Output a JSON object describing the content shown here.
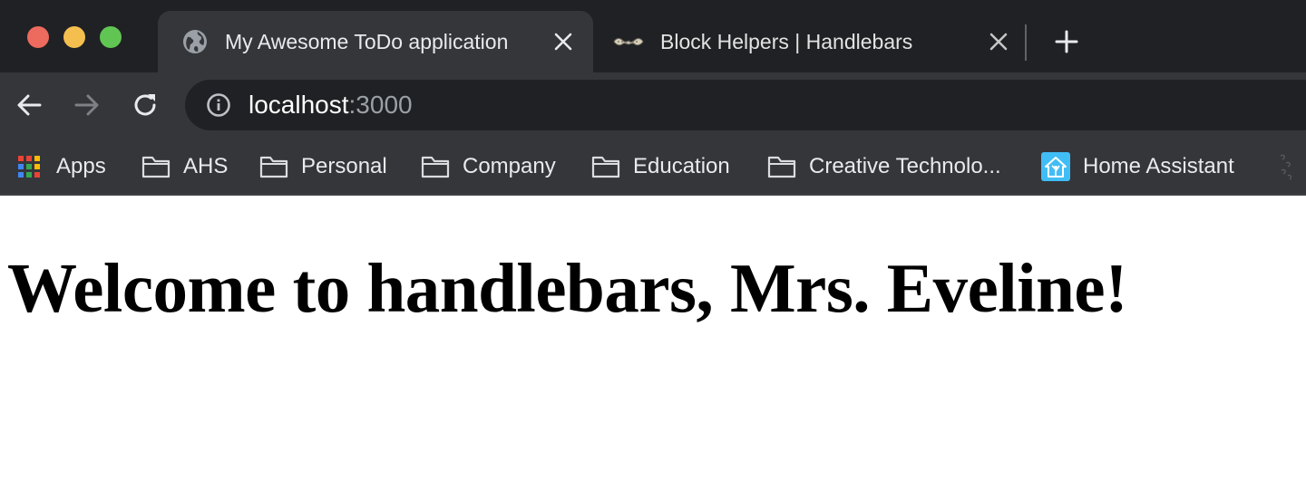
{
  "tabs": [
    {
      "title": "My Awesome ToDo application",
      "icon": "globe-icon",
      "active": true
    },
    {
      "title": "Block Helpers | Handlebars",
      "icon": "handlebars-mustache-icon",
      "active": false
    }
  ],
  "toolbar": {
    "back_icon": "back-arrow-icon",
    "forward_icon": "forward-arrow-icon",
    "reload_icon": "reload-icon",
    "url_host": "localhost",
    "url_port": ":3000"
  },
  "bookmarks": [
    {
      "label": "Apps",
      "icon": "apps-grid-icon"
    },
    {
      "label": "AHS",
      "icon": "folder-icon"
    },
    {
      "label": "Personal",
      "icon": "folder-icon"
    },
    {
      "label": "Company",
      "icon": "folder-icon"
    },
    {
      "label": "Education",
      "icon": "folder-icon"
    },
    {
      "label": "Creative Technolo...",
      "icon": "folder-icon"
    },
    {
      "label": "Home Assistant",
      "icon": "home-assistant-icon"
    }
  ],
  "page": {
    "heading": "Welcome to handlebars, Mrs. Eveline!"
  },
  "colors": {
    "tabstrip_bg": "#202124",
    "toolbar_bg": "#35363a",
    "traffic_red": "#ed6a5e",
    "traffic_yellow": "#f4bf4f",
    "traffic_green": "#61c554"
  }
}
